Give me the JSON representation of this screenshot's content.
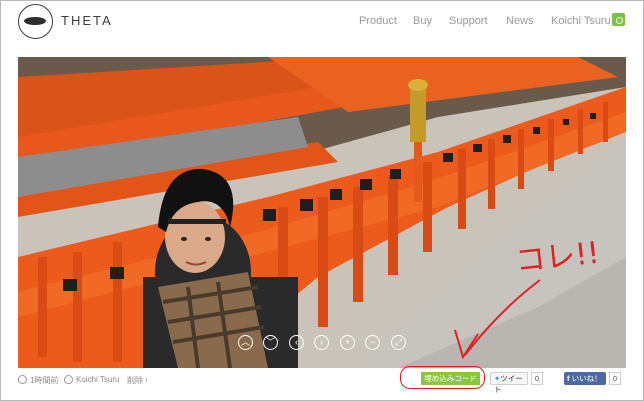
{
  "header": {
    "brand": "THETA",
    "nav": [
      "Product",
      "Buy",
      "Support",
      "News",
      "Koichi Tsuru"
    ]
  },
  "viewer": {
    "controls": [
      "chevron-up-icon",
      "chevron-down-icon",
      "chevron-left-icon",
      "chevron-right-icon",
      "zoom-in-icon",
      "zoom-out-icon",
      "fullscreen-icon"
    ]
  },
  "footer": {
    "time_ago": "1時間前",
    "author": "Koichi Tsuru",
    "delete": "削除",
    "embed_code": "埋め込みコード",
    "tweet": "ツイート",
    "tweet_count": "0",
    "like": "いいね！",
    "like_count": "0"
  },
  "annotation": {
    "text": "コレ!!",
    "color": "#e02020"
  },
  "colors": {
    "accent_green": "#7dc242",
    "facebook_blue": "#4e69a2",
    "shrine_orange": "#ec5a1c"
  }
}
